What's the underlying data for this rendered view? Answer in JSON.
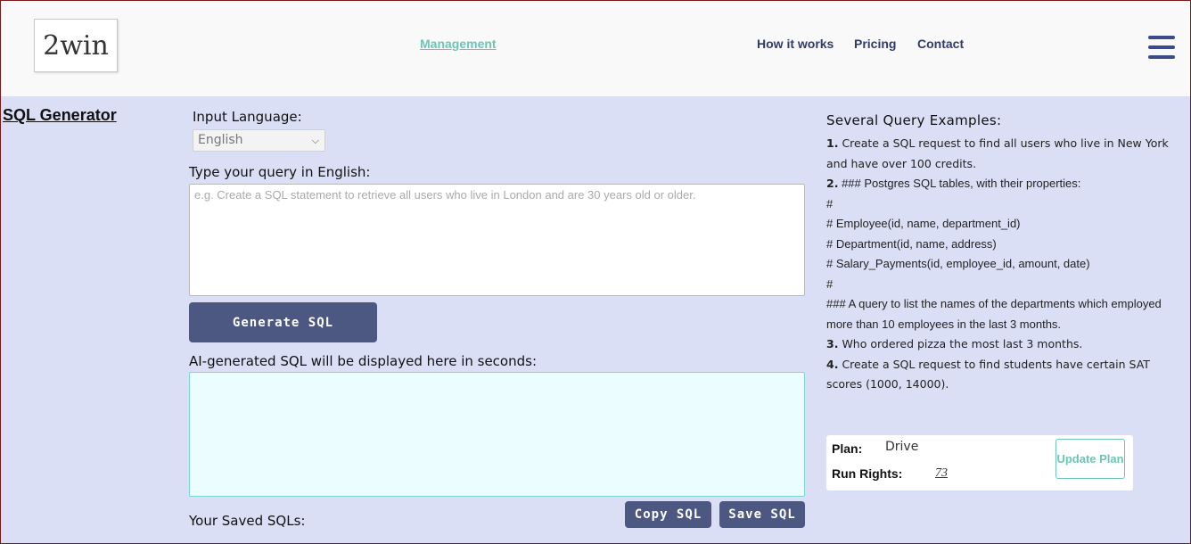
{
  "header": {
    "logo_text": "2win",
    "nav": {
      "management": "Management",
      "how_it_works": "How it works",
      "pricing": "Pricing",
      "contact": "Contact"
    }
  },
  "main": {
    "title": "SQL Generator",
    "input_language_label": "Input Language:",
    "language_selected": "English",
    "type_query_label": "Type your query in English:",
    "query_placeholder": "e.g. Create a SQL statement to retrieve all users who live in London and are 30 years old or older.",
    "generate_label": "Generate SQL",
    "output_label": "AI-generated SQL will be displayed here in seconds:",
    "copy_label": "Copy SQL",
    "save_label": "Save SQL",
    "saved_label": "Your Saved SQLs:"
  },
  "examples": {
    "title": "Several Query Examples:",
    "ex1_num": "1.",
    "ex1_text": "Create a SQL request to find all users who live in New York and have over 100 credits.",
    "ex2_num": "2.",
    "ex2_lines": [
      "### Postgres SQL tables, with their properties:",
      "#",
      "# Employee(id, name, department_id)",
      "# Department(id, name, address)",
      "# Salary_Payments(id, employee_id, amount, date)",
      "#",
      "### A query to list the names of the departments which employed more than 10 employees in the last 3 months."
    ],
    "ex3_num": "3.",
    "ex3_text": "Who ordered pizza the most last 3 months.",
    "ex4_num": "4.",
    "ex4_text": "Create a SQL request to find students have certain SAT scores (1000, 14000)."
  },
  "plan": {
    "plan_label": "Plan:",
    "plan_value": "Drive",
    "run_label": "Run Rights:",
    "run_value": "73",
    "update_label": "Update Plan"
  }
}
